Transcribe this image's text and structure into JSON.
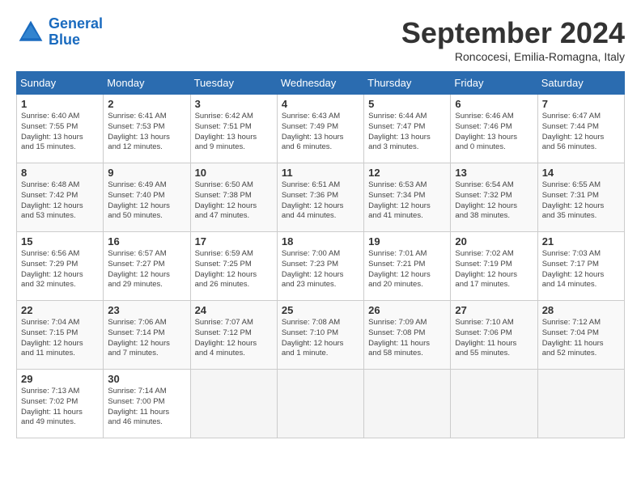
{
  "header": {
    "logo_line1": "General",
    "logo_line2": "Blue",
    "title": "September 2024",
    "subtitle": "Roncocesi, Emilia-Romagna, Italy"
  },
  "days_of_week": [
    "Sunday",
    "Monday",
    "Tuesday",
    "Wednesday",
    "Thursday",
    "Friday",
    "Saturday"
  ],
  "weeks": [
    [
      {
        "day": 1,
        "info": "Sunrise: 6:40 AM\nSunset: 7:55 PM\nDaylight: 13 hours\nand 15 minutes."
      },
      {
        "day": 2,
        "info": "Sunrise: 6:41 AM\nSunset: 7:53 PM\nDaylight: 13 hours\nand 12 minutes."
      },
      {
        "day": 3,
        "info": "Sunrise: 6:42 AM\nSunset: 7:51 PM\nDaylight: 13 hours\nand 9 minutes."
      },
      {
        "day": 4,
        "info": "Sunrise: 6:43 AM\nSunset: 7:49 PM\nDaylight: 13 hours\nand 6 minutes."
      },
      {
        "day": 5,
        "info": "Sunrise: 6:44 AM\nSunset: 7:47 PM\nDaylight: 13 hours\nand 3 minutes."
      },
      {
        "day": 6,
        "info": "Sunrise: 6:46 AM\nSunset: 7:46 PM\nDaylight: 13 hours\nand 0 minutes."
      },
      {
        "day": 7,
        "info": "Sunrise: 6:47 AM\nSunset: 7:44 PM\nDaylight: 12 hours\nand 56 minutes."
      }
    ],
    [
      {
        "day": 8,
        "info": "Sunrise: 6:48 AM\nSunset: 7:42 PM\nDaylight: 12 hours\nand 53 minutes."
      },
      {
        "day": 9,
        "info": "Sunrise: 6:49 AM\nSunset: 7:40 PM\nDaylight: 12 hours\nand 50 minutes."
      },
      {
        "day": 10,
        "info": "Sunrise: 6:50 AM\nSunset: 7:38 PM\nDaylight: 12 hours\nand 47 minutes."
      },
      {
        "day": 11,
        "info": "Sunrise: 6:51 AM\nSunset: 7:36 PM\nDaylight: 12 hours\nand 44 minutes."
      },
      {
        "day": 12,
        "info": "Sunrise: 6:53 AM\nSunset: 7:34 PM\nDaylight: 12 hours\nand 41 minutes."
      },
      {
        "day": 13,
        "info": "Sunrise: 6:54 AM\nSunset: 7:32 PM\nDaylight: 12 hours\nand 38 minutes."
      },
      {
        "day": 14,
        "info": "Sunrise: 6:55 AM\nSunset: 7:31 PM\nDaylight: 12 hours\nand 35 minutes."
      }
    ],
    [
      {
        "day": 15,
        "info": "Sunrise: 6:56 AM\nSunset: 7:29 PM\nDaylight: 12 hours\nand 32 minutes."
      },
      {
        "day": 16,
        "info": "Sunrise: 6:57 AM\nSunset: 7:27 PM\nDaylight: 12 hours\nand 29 minutes."
      },
      {
        "day": 17,
        "info": "Sunrise: 6:59 AM\nSunset: 7:25 PM\nDaylight: 12 hours\nand 26 minutes."
      },
      {
        "day": 18,
        "info": "Sunrise: 7:00 AM\nSunset: 7:23 PM\nDaylight: 12 hours\nand 23 minutes."
      },
      {
        "day": 19,
        "info": "Sunrise: 7:01 AM\nSunset: 7:21 PM\nDaylight: 12 hours\nand 20 minutes."
      },
      {
        "day": 20,
        "info": "Sunrise: 7:02 AM\nSunset: 7:19 PM\nDaylight: 12 hours\nand 17 minutes."
      },
      {
        "day": 21,
        "info": "Sunrise: 7:03 AM\nSunset: 7:17 PM\nDaylight: 12 hours\nand 14 minutes."
      }
    ],
    [
      {
        "day": 22,
        "info": "Sunrise: 7:04 AM\nSunset: 7:15 PM\nDaylight: 12 hours\nand 11 minutes."
      },
      {
        "day": 23,
        "info": "Sunrise: 7:06 AM\nSunset: 7:14 PM\nDaylight: 12 hours\nand 7 minutes."
      },
      {
        "day": 24,
        "info": "Sunrise: 7:07 AM\nSunset: 7:12 PM\nDaylight: 12 hours\nand 4 minutes."
      },
      {
        "day": 25,
        "info": "Sunrise: 7:08 AM\nSunset: 7:10 PM\nDaylight: 12 hours\nand 1 minute."
      },
      {
        "day": 26,
        "info": "Sunrise: 7:09 AM\nSunset: 7:08 PM\nDaylight: 11 hours\nand 58 minutes."
      },
      {
        "day": 27,
        "info": "Sunrise: 7:10 AM\nSunset: 7:06 PM\nDaylight: 11 hours\nand 55 minutes."
      },
      {
        "day": 28,
        "info": "Sunrise: 7:12 AM\nSunset: 7:04 PM\nDaylight: 11 hours\nand 52 minutes."
      }
    ],
    [
      {
        "day": 29,
        "info": "Sunrise: 7:13 AM\nSunset: 7:02 PM\nDaylight: 11 hours\nand 49 minutes."
      },
      {
        "day": 30,
        "info": "Sunrise: 7:14 AM\nSunset: 7:00 PM\nDaylight: 11 hours\nand 46 minutes."
      },
      null,
      null,
      null,
      null,
      null
    ]
  ]
}
